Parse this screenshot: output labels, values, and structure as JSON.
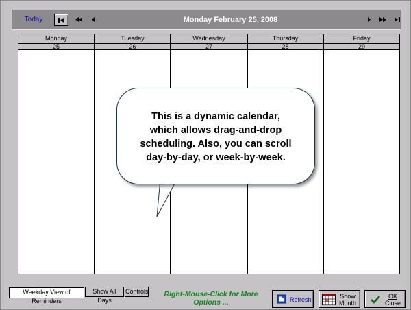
{
  "header": {
    "today_label": "Today",
    "date_title": "Monday February 25, 2008",
    "nav_icons": [
      "skip-to-first-icon",
      "double-left-arrow-icon",
      "left-arrow-icon",
      "right-arrow-icon",
      "double-right-arrow-icon",
      "skip-to-last-icon"
    ]
  },
  "calendar": {
    "days": [
      {
        "name": "Monday",
        "date": "25"
      },
      {
        "name": "Tuesday",
        "date": "26"
      },
      {
        "name": "Wednesday",
        "date": "27"
      },
      {
        "name": "Thursday",
        "date": "28"
      },
      {
        "name": "Friday",
        "date": "29"
      }
    ]
  },
  "callout": {
    "lines": [
      "This is a dynamic calendar,",
      "which allows drag-and-drop",
      "scheduling. Also, you can scroll",
      "day-by-day, or week-by-week."
    ]
  },
  "tabs": {
    "weekday": "Weekday View of Reminders",
    "show_all": "Show All Days",
    "controls": "Controls"
  },
  "footer": {
    "hint_line1": "Right-Mouse-Click for More",
    "hint_line2": "Options ...",
    "refresh_label": "Refresh",
    "show_month_line1": "Show",
    "show_month_line2": "Month",
    "ok_line1": "OK",
    "ok_line2": "Close"
  },
  "colors": {
    "header_bg": "#8c8a8c",
    "window_bg": "#c6c3c6",
    "hint_green": "#0d8a1a",
    "link_blue": "#1010b0"
  }
}
